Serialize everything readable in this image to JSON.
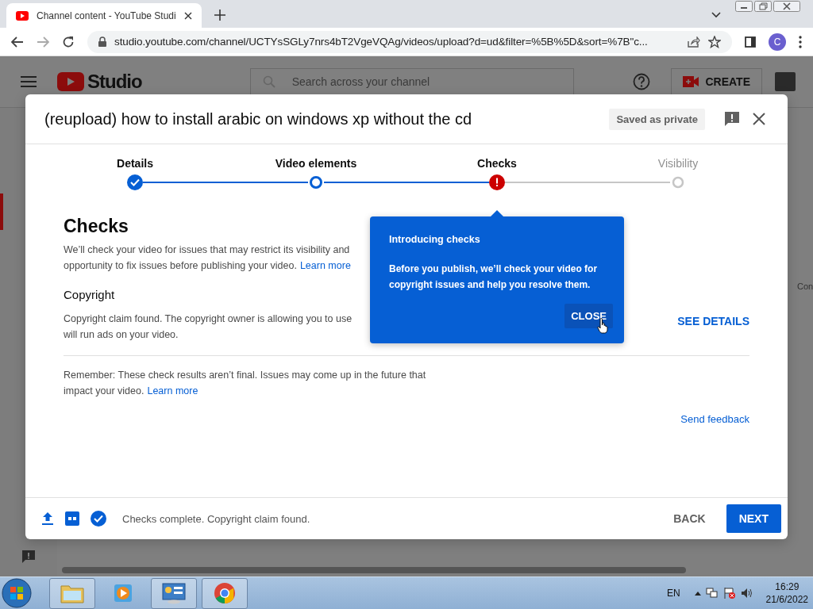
{
  "browser": {
    "tab_title": "Channel content - YouTube Studi",
    "address": "studio.youtube.com/channel/UCTYsSGLy7nrs4bT2VgeVQAg/videos/upload?d=ud&filter=%5B%5D&sort=%7B\"c...",
    "profile": "C"
  },
  "studio": {
    "logo": "Studio",
    "search_placeholder": "Search across your channel",
    "create": "CREATE",
    "side_text": "Con"
  },
  "dialog": {
    "title": "(reupload) how to install arabic on windows xp without the cd",
    "save_status": "Saved as private",
    "steps": [
      {
        "label": "Details",
        "reached": true,
        "completed": true,
        "warning": false
      },
      {
        "label": "Video elements",
        "reached": true,
        "completed": false,
        "warning": false
      },
      {
        "label": "Checks",
        "reached": true,
        "completed": false,
        "warning": true
      },
      {
        "label": "Visibility",
        "reached": false,
        "completed": false,
        "warning": false
      }
    ],
    "heading": "Checks",
    "intro_lines": [
      "We’ll check your video for issues that may restrict its visibility and",
      "opportunity to fix issues before publishing your video."
    ],
    "intro_link": "Learn more",
    "copyright": {
      "title": "Copyright",
      "lines": [
        "Copyright claim found. The copyright owner is allowing you to use",
        "will run ads on your video."
      ],
      "action": "SEE DETAILS"
    },
    "reminder_lines": [
      "Remember: These check results aren’t final. Issues may come up in the future that",
      "impact your video."
    ],
    "reminder_link": "Learn more",
    "feedback": "Send feedback",
    "footer": {
      "status": "Checks complete. Copyright claim found.",
      "back": "BACK",
      "next": "NEXT"
    }
  },
  "tooltip": {
    "title": "Introducing checks",
    "body_lines": [
      "Before you publish, we’ll check your video for",
      "copyright issues and help you resolve them."
    ],
    "close": "CLOSE"
  },
  "taskbar": {
    "apps": [
      {
        "kind": "folder",
        "open": true
      },
      {
        "kind": "player",
        "open": false
      },
      {
        "kind": "panel",
        "open": true
      },
      {
        "kind": "chrome",
        "open": true
      }
    ],
    "language": "EN",
    "time": "16:29",
    "date": "21/6/2022"
  }
}
